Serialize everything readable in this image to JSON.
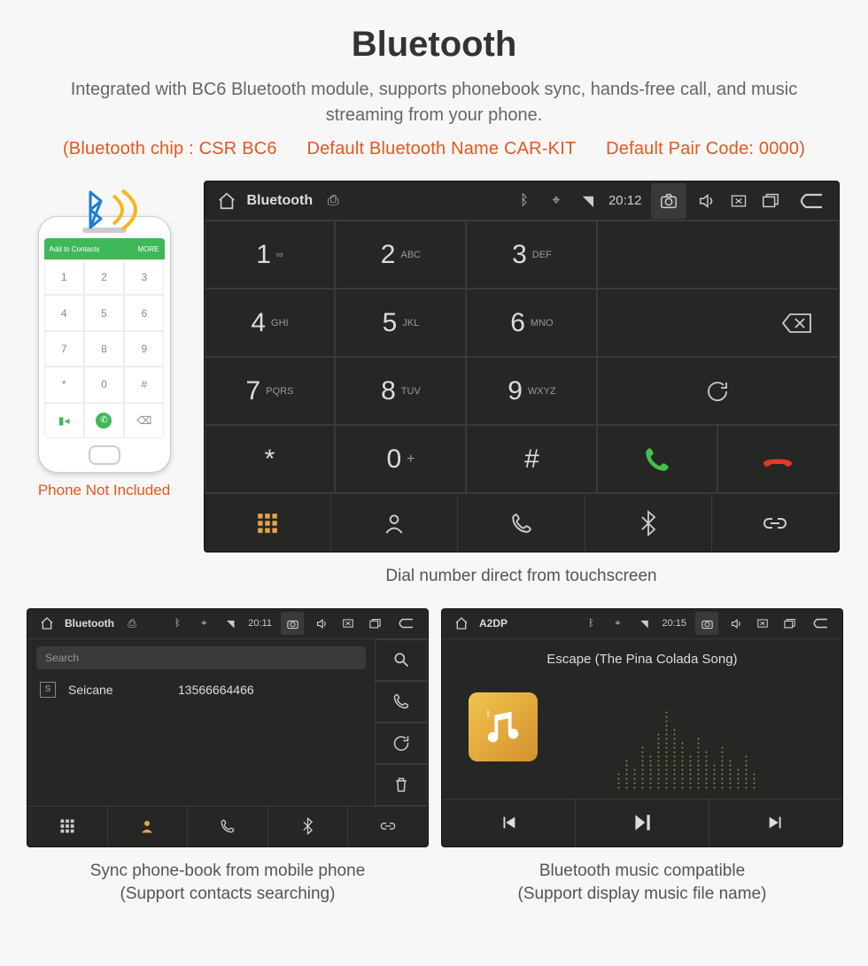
{
  "title": "Bluetooth",
  "description": "Integrated with BC6 Bluetooth module, supports phonebook sync, hands-free call, and music streaming from your phone.",
  "specs": {
    "chip": "(Bluetooth chip : CSR BC6",
    "name": "Default Bluetooth Name CAR-KIT",
    "pair": "Default Pair Code: 0000)"
  },
  "phone": {
    "add_contacts": "Add to Contacts",
    "more": "MORE",
    "not_included": "Phone Not Included"
  },
  "dialer": {
    "status": {
      "app": "Bluetooth",
      "time": "20:12"
    },
    "keys": [
      {
        "num": "1",
        "sub": "∞"
      },
      {
        "num": "2",
        "sub": "ABC"
      },
      {
        "num": "3",
        "sub": "DEF"
      },
      {
        "num": "4",
        "sub": "GHI"
      },
      {
        "num": "5",
        "sub": "JKL"
      },
      {
        "num": "6",
        "sub": "MNO"
      },
      {
        "num": "7",
        "sub": "PQRS"
      },
      {
        "num": "8",
        "sub": "TUV"
      },
      {
        "num": "9",
        "sub": "WXYZ"
      },
      {
        "num": "*",
        "sub": ""
      },
      {
        "num": "0",
        "sub": "+"
      },
      {
        "num": "#",
        "sub": ""
      }
    ],
    "caption": "Dial number direct from touchscreen"
  },
  "contacts": {
    "status": {
      "app": "Bluetooth",
      "time": "20:11"
    },
    "search": "Search",
    "list": [
      {
        "tag": "S",
        "name": "Seicane",
        "number": "13566664466"
      }
    ],
    "caption_l1": "Sync phone-book from mobile phone",
    "caption_l2": "(Support contacts searching)"
  },
  "music": {
    "status": {
      "app": "A2DP",
      "time": "20:15"
    },
    "track": "Escape (The Pina Colada Song)",
    "caption_l1": "Bluetooth music compatible",
    "caption_l2": "(Support display music file name)"
  }
}
